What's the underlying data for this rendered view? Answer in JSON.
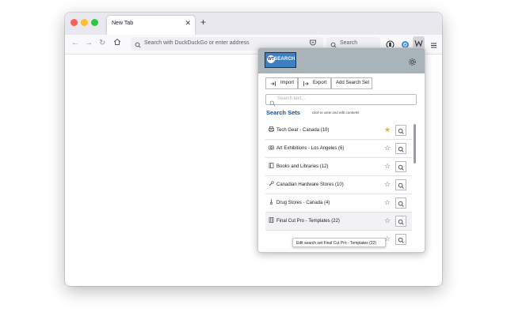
{
  "browser": {
    "tab_title": "New Tab",
    "tab_close": "✕",
    "new_tab": "+",
    "url_placeholder": "Search with DuckDuckGo or enter address",
    "search_placeholder": "Search",
    "icons": [
      "back-icon",
      "forward-icon",
      "reload-icon",
      "home-icon",
      "search-icon",
      "pocket-icon",
      "account-icon",
      "extension-icon",
      "menu-icon"
    ]
  },
  "popup": {
    "logo_text": "SEARCH",
    "logo_mark": "WT",
    "buttons": {
      "import": "Import",
      "export": "Export",
      "add": "Add Search Set"
    },
    "search_placeholder": "Search text...",
    "sets_title": "Search Sets",
    "sets_hint": "click to view and edit contents",
    "rows": [
      {
        "label": "Tech Gear - Canada (10)",
        "icon": "printer-icon",
        "starred": true
      },
      {
        "label": "Art Exhibitions - Los Angeles (6)",
        "icon": "camera-icon",
        "starred": false
      },
      {
        "label": "Books and Libraries (12)",
        "icon": "book-icon",
        "starred": false
      },
      {
        "label": "Canadian Hardware Stores (10)",
        "icon": "wrench-icon",
        "starred": false
      },
      {
        "label": "Drug Stores - Canada (4)",
        "icon": "thermometer-icon",
        "starred": false
      },
      {
        "label": "Final Cut Pro - Templates (22)",
        "icon": "film-icon",
        "starred": false
      }
    ],
    "tooltip": "Edit search set Final Cut Pro - Templates (22)"
  },
  "colors": {
    "accent": "#1d4f8a",
    "star": "#e5b50f",
    "header": "#a8b4b9"
  }
}
